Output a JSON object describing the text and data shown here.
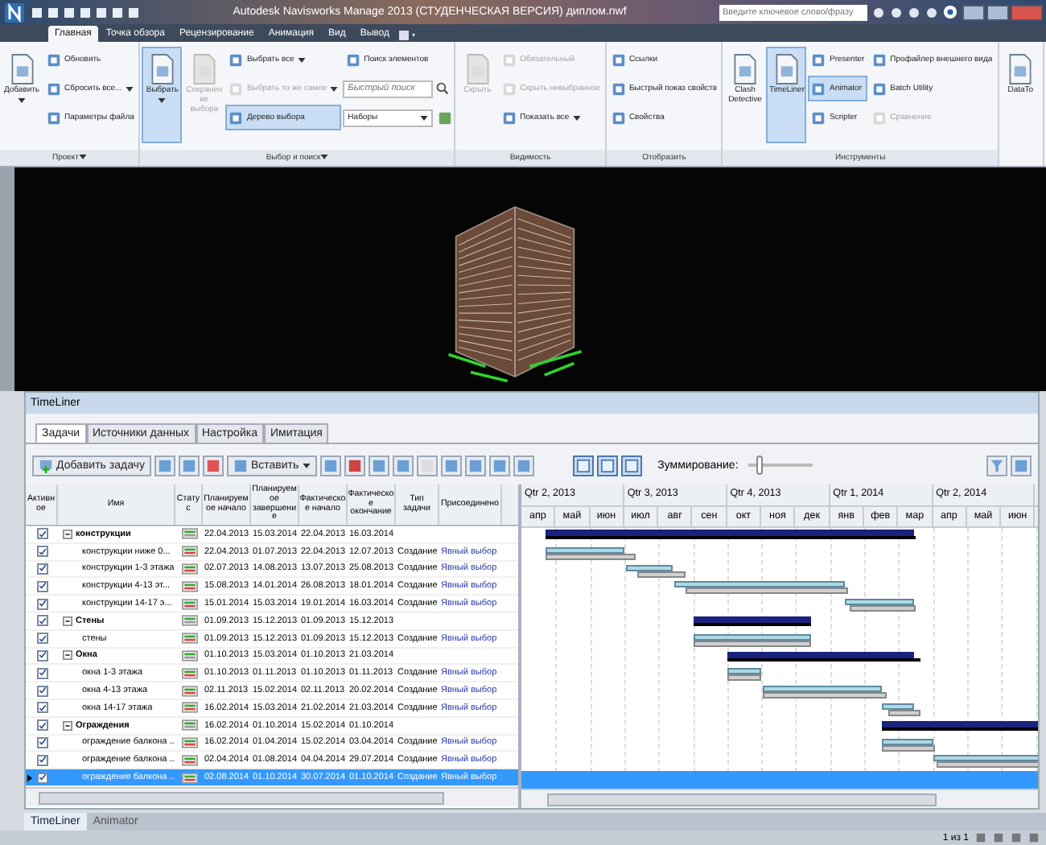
{
  "title_bar": {
    "title": "Autodesk Navisworks Manage 2013 (СТУДЕНЧЕСКАЯ ВЕРСИЯ)   диплом.nwf",
    "search": {
      "placeholder": "Введите ключевое слово/фразу"
    }
  },
  "ribbon_tabs": [
    {
      "label": "Главная",
      "selected": true
    },
    {
      "label": "Точка обзора",
      "selected": false
    },
    {
      "label": "Рецензирование",
      "selected": false
    },
    {
      "label": "Анимация",
      "selected": false
    },
    {
      "label": "Вид",
      "selected": false
    },
    {
      "label": "Вывод",
      "selected": false
    }
  ],
  "ribbon_groups": [
    {
      "label": "Проект",
      "dropdown": true,
      "columns": [
        [
          {
            "kind": "large",
            "label": "Добавить",
            "dropdown": true,
            "on": false,
            "disabled": false
          }
        ],
        [
          {
            "kind": "small",
            "label": "Обновить",
            "on": false,
            "disabled": false
          },
          {
            "kind": "small",
            "label": "Сбросить все...",
            "dropdown": true,
            "on": false,
            "disabled": false
          },
          {
            "kind": "small",
            "label": "Параметры файла",
            "on": false,
            "disabled": false
          }
        ]
      ]
    },
    {
      "label": "Выбор и поиск",
      "dropdown": true,
      "columns": [
        [
          {
            "kind": "large",
            "label": "Выбрать",
            "dropdown": true,
            "on": true,
            "disabled": false
          }
        ],
        [
          {
            "kind": "large",
            "label": "Сохранение выбора",
            "on": false,
            "disabled": true
          }
        ],
        [
          {
            "kind": "small",
            "label": "Выбрать все",
            "dropdown": true,
            "on": false,
            "disabled": false
          },
          {
            "kind": "small",
            "label": "Выбрать то же самое",
            "dropdown": true,
            "on": false,
            "disabled": true
          },
          {
            "kind": "small",
            "label": "Дерево выбора",
            "on": true,
            "disabled": false
          }
        ],
        [
          {
            "kind": "small",
            "label": "Поиск элементов",
            "on": false,
            "disabled": false
          },
          {
            "kind": "field",
            "placeholder": "Быстрый поиск"
          },
          {
            "kind": "dropdown",
            "label": "Наборы"
          }
        ]
      ]
    },
    {
      "label": "Видимость",
      "dropdown": false,
      "columns": [
        [
          {
            "kind": "large",
            "label": "Скрыть",
            "on": false,
            "disabled": true
          }
        ],
        [
          {
            "kind": "small",
            "label": "Обязательный",
            "on": false,
            "disabled": true
          },
          {
            "kind": "small",
            "label": "Скрыть невыбранное",
            "on": false,
            "disabled": true
          },
          {
            "kind": "small",
            "label": "Показать все",
            "dropdown": true,
            "on": false,
            "disabled": false
          }
        ]
      ]
    },
    {
      "label": "Отобразить",
      "dropdown": false,
      "columns": [
        [
          {
            "kind": "small",
            "label": "Ссылки",
            "on": false,
            "disabled": false
          },
          {
            "kind": "small",
            "label": "Быстрый показ свойств",
            "on": false,
            "disabled": false
          },
          {
            "kind": "small",
            "label": "Свойства",
            "on": false,
            "disabled": false
          }
        ]
      ]
    },
    {
      "label": "Инструменты",
      "dropdown": false,
      "columns": [
        [
          {
            "kind": "large",
            "label": "Clash Detective",
            "on": false,
            "disabled": false
          }
        ],
        [
          {
            "kind": "large",
            "label": "TimeLiner",
            "on": true,
            "disabled": false
          }
        ],
        [
          {
            "kind": "small",
            "label": "Presenter",
            "on": false,
            "disabled": false
          },
          {
            "kind": "small",
            "label": "Animator",
            "on": true,
            "disabled": false
          },
          {
            "kind": "small",
            "label": "Scripter",
            "on": false,
            "disabled": false
          }
        ],
        [
          {
            "kind": "small",
            "label": "Профайлер внешнего вида",
            "on": false,
            "disabled": false
          },
          {
            "kind": "small",
            "label": "Batch Utility",
            "on": false,
            "disabled": false
          },
          {
            "kind": "small",
            "label": "Сравнение",
            "on": false,
            "disabled": true
          }
        ]
      ]
    },
    {
      "columns": [
        [
          {
            "kind": "large",
            "label": "DataTo",
            "on": false,
            "disabled": false
          }
        ]
      ]
    }
  ],
  "timeliner": {
    "title": "TimeLiner",
    "tabs": [
      {
        "label": "Задачи",
        "selected": true
      },
      {
        "label": "Источники данных",
        "selected": false
      },
      {
        "label": "Настройка",
        "selected": false
      },
      {
        "label": "Имитация",
        "selected": false
      }
    ],
    "toolbar": {
      "add_task": "Добавить задачу",
      "insert": "Вставить",
      "zoom_label": "Зуммирование:",
      "zoom": {
        "level": 0.12
      }
    },
    "columns": [
      "Активное",
      "Имя",
      "Статус",
      "Планируемое начало",
      "Планируемое завершение",
      "Фактическое начало",
      "Фактическое окончание",
      "Тип задачи",
      "Присоединено"
    ],
    "quarters": [
      "Qtr 2, 2013",
      "Qtr 3, 2013",
      "Qtr 4, 2013",
      "Qtr 1, 2014",
      "Qtr 2, 2014"
    ],
    "months": [
      "апр",
      "май",
      "июн",
      "июл",
      "авг",
      "сен",
      "окт",
      "ноя",
      "дек",
      "янв",
      "фев",
      "мар",
      "апр",
      "май",
      "июн"
    ],
    "tasks": [
      {
        "name": "конструкции",
        "active": true,
        "selected": false,
        "expanded": true,
        "plan_start": "22.04.2013",
        "plan_end": "15.03.2014",
        "actual_start": "22.04.2013",
        "actual_end": "16.03.2014",
        "children": [
          {
            "name": "конструкции ниже 0...",
            "active": true,
            "selected": false,
            "plan_start": "22.04.2013",
            "plan_end": "01.07.2013",
            "actual_start": "22.04.2013",
            "actual_end": "12.07.2013",
            "type": "Создание",
            "attached": "Явный выбор"
          },
          {
            "name": "конструкции 1-3 этажа",
            "active": true,
            "selected": false,
            "plan_start": "02.07.2013",
            "plan_end": "14.08.2013",
            "actual_start": "13.07.2013",
            "actual_end": "25.08.2013",
            "type": "Создание",
            "attached": "Явный выбор"
          },
          {
            "name": "конструкции 4-13 эт...",
            "active": true,
            "selected": false,
            "plan_start": "15.08.2013",
            "plan_end": "14.01.2014",
            "actual_start": "26.08.2013",
            "actual_end": "18.01.2014",
            "type": "Создание",
            "attached": "Явный выбор"
          },
          {
            "name": "конструкции 14-17 э...",
            "active": true,
            "selected": false,
            "plan_start": "15.01.2014",
            "plan_end": "15.03.2014",
            "actual_start": "19.01.2014",
            "actual_end": "16.03.2014",
            "type": "Создание",
            "attached": "Явный выбор"
          }
        ]
      },
      {
        "name": "Стены",
        "active": true,
        "selected": false,
        "expanded": true,
        "plan_start": "01.09.2013",
        "plan_end": "15.12.2013",
        "actual_start": "01.09.2013",
        "actual_end": "15.12.2013",
        "children": [
          {
            "name": "стены",
            "active": true,
            "selected": false,
            "plan_start": "01.09.2013",
            "plan_end": "15.12.2013",
            "actual_start": "01.09.2013",
            "actual_end": "15.12.2013",
            "type": "Создание",
            "attached": "Явный выбор"
          }
        ]
      },
      {
        "name": "Окна",
        "active": true,
        "selected": false,
        "expanded": true,
        "plan_start": "01.10.2013",
        "plan_end": "15.03.2014",
        "actual_start": "01.10.2013",
        "actual_end": "21.03.2014",
        "children": [
          {
            "name": "окна 1-3 этажа",
            "active": true,
            "selected": false,
            "plan_start": "01.10.2013",
            "plan_end": "01.11.2013",
            "actual_start": "01.10.2013",
            "actual_end": "01.11.2013",
            "type": "Создание",
            "attached": "Явный выбор"
          },
          {
            "name": "окна 4-13 этажа",
            "active": true,
            "selected": false,
            "plan_start": "02.11.2013",
            "plan_end": "15.02.2014",
            "actual_start": "02.11.2013",
            "actual_end": "20.02.2014",
            "type": "Создание",
            "attached": "Явный выбор"
          },
          {
            "name": "окна 14-17 этажа",
            "active": true,
            "selected": false,
            "plan_start": "16.02.2014",
            "plan_end": "15.03.2014",
            "actual_start": "21.02.2014",
            "actual_end": "21.03.2014",
            "type": "Создание",
            "attached": "Явный выбор"
          }
        ]
      },
      {
        "name": "Ограждения",
        "active": true,
        "selected": false,
        "expanded": true,
        "plan_start": "16.02.2014",
        "plan_end": "01.10.2014",
        "actual_start": "15.02.2014",
        "actual_end": "01.10.2014",
        "children": [
          {
            "name": "ограждение балкона ...",
            "active": true,
            "selected": false,
            "plan_start": "16.02.2014",
            "plan_end": "01.04.2014",
            "actual_start": "15.02.2014",
            "actual_end": "03.04.2014",
            "type": "Создание",
            "attached": "Явный выбор"
          },
          {
            "name": "ограждение балкона ...",
            "active": true,
            "selected": false,
            "plan_start": "02.04.2014",
            "plan_end": "01.08.2014",
            "actual_start": "04.04.2014",
            "actual_end": "29.07.2014",
            "type": "Создание",
            "attached": "Явный выбор"
          },
          {
            "name": "ограждение балкона ...",
            "active": true,
            "selected": true,
            "plan_start": "02.08.2014",
            "plan_end": "01.10.2014",
            "actual_start": "30.07.2014",
            "actual_end": "01.10.2014",
            "type": "Создание",
            "attached": "Явный выбор"
          }
        ]
      }
    ]
  },
  "bottom_tabs": [
    {
      "label": "TimeLiner",
      "selected": true
    },
    {
      "label": "Animator",
      "selected": false
    }
  ],
  "status_bar": {
    "page": "1 из 1"
  }
}
